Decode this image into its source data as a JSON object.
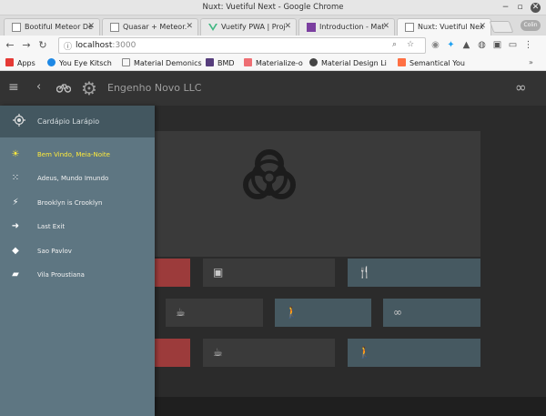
{
  "window": {
    "title": "Nuxt: Vuetiful Next - Google Chrome"
  },
  "tabs": [
    {
      "label": "Bootiful Meteor De",
      "favicon_color": "#9e9e9e"
    },
    {
      "label": "Quasar + Meteor.",
      "favicon_color": "#9e9e9e"
    },
    {
      "label": "Vuetify PWA | Proj",
      "favicon_color": "#41b883"
    },
    {
      "label": "Introduction - Mat",
      "favicon_color": "#7b3fa0"
    },
    {
      "label": "Nuxt: Vuetiful Nex",
      "favicon_color": "#9e9e9e",
      "active": true
    }
  ],
  "profile": {
    "label": "Colin"
  },
  "address": {
    "host": "localhost",
    "port": ":3000"
  },
  "bookmarks": [
    {
      "label": "Apps",
      "color": "#e53935"
    },
    {
      "label": "You Eye Kitsch",
      "color": "#1e88e5"
    },
    {
      "label": "Material Demonics",
      "color": "#9e9e9e"
    },
    {
      "label": "BMD",
      "color": "#563d7c"
    },
    {
      "label": "Materialize-o",
      "color": "#ee6e73"
    },
    {
      "label": "Material Design Li",
      "color": "#444444"
    },
    {
      "label": "Semantical You",
      "color": "#ff7043"
    }
  ],
  "appbar": {
    "brand": "Engenho Novo LLC"
  },
  "drawer": {
    "header": "Cardápio Larápio",
    "items": [
      {
        "label": "Bem Vindo, Meia-Noite",
        "icon": "sun-icon",
        "glyph": "☀",
        "active": true
      },
      {
        "label": "Adeus, Mundo Imundo",
        "icon": "scatter-icon",
        "glyph": "⁙"
      },
      {
        "label": "Brooklyn is Crooklyn",
        "icon": "bolt-icon",
        "glyph": "⚡"
      },
      {
        "label": "Last Exit",
        "icon": "exit-icon",
        "glyph": "➜"
      },
      {
        "label": "Sao Pavlov",
        "icon": "directions-icon",
        "glyph": "◆"
      },
      {
        "label": "Vila Proustiana",
        "icon": "book-icon",
        "glyph": "▰"
      }
    ]
  },
  "tiles": [
    {
      "icon": "blank",
      "glyph": "",
      "color": "red"
    },
    {
      "icon": "cube-icon",
      "glyph": "▣",
      "color": "dark"
    },
    {
      "icon": "restaurant-icon",
      "glyph": "🍴",
      "color": "slate"
    },
    {
      "icon": "coffee-icon",
      "glyph": "☕",
      "color": "dark"
    },
    {
      "icon": "walk-icon",
      "glyph": "🚶",
      "color": "slate"
    },
    {
      "icon": "infinity-icon",
      "glyph": "∞",
      "color": "slate"
    },
    {
      "icon": "blank",
      "glyph": "",
      "color": "red"
    },
    {
      "icon": "coffee-icon",
      "glyph": "☕",
      "color": "dark"
    },
    {
      "icon": "walk-icon",
      "glyph": "🚶",
      "color": "slate"
    }
  ],
  "colors": {
    "drawer": "#5e7682",
    "drawer_header": "#435760",
    "active_item": "#ffeb3b",
    "tile_red": "#9c3b3b",
    "tile_dark": "#3a3a3a",
    "tile_slate": "#465961"
  }
}
